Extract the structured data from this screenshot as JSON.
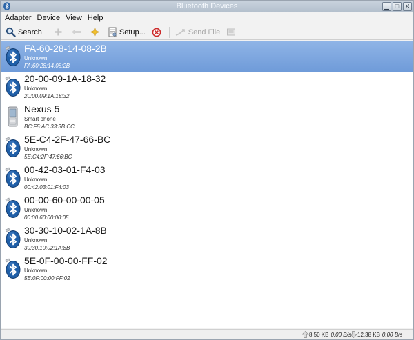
{
  "window": {
    "title": "Bluetooth Devices"
  },
  "menu": [
    {
      "first": "A",
      "rest": "dapter"
    },
    {
      "first": "D",
      "rest": "evice"
    },
    {
      "first": "V",
      "rest": "iew"
    },
    {
      "first": "H",
      "rest": "elp"
    }
  ],
  "toolbar": {
    "search_label": "Search",
    "setup_label": "Setup...",
    "send_file_label": "Send File"
  },
  "devices": [
    {
      "name": "FA-60-28-14-08-2B",
      "type": "Unknown",
      "address": "FA:60:28:14:08:2B",
      "icon": "bluetooth-icon",
      "selected": true
    },
    {
      "name": "20-00-09-1A-18-32",
      "type": "Unknown",
      "address": "20:00:09:1A:18:32",
      "icon": "bluetooth-icon",
      "selected": false
    },
    {
      "name": "Nexus 5",
      "type": "Smart phone",
      "address": "BC:F5:AC:33:3B:CC",
      "icon": "phone-icon",
      "selected": false
    },
    {
      "name": "5E-C4-2F-47-66-BC",
      "type": "Unknown",
      "address": "5E:C4:2F:47:66:BC",
      "icon": "bluetooth-icon",
      "selected": false
    },
    {
      "name": "00-42-03-01-F4-03",
      "type": "Unknown",
      "address": "00:42:03:01:F4:03",
      "icon": "bluetooth-icon",
      "selected": false
    },
    {
      "name": "00-00-60-00-00-05",
      "type": "Unknown",
      "address": "00:00:60:00:00:05",
      "icon": "bluetooth-icon",
      "selected": false
    },
    {
      "name": "30-30-10-02-1A-8B",
      "type": "Unknown",
      "address": "30:30:10:02:1A:8B",
      "icon": "bluetooth-icon",
      "selected": false
    },
    {
      "name": "5E-0F-00-00-FF-02",
      "type": "Unknown",
      "address": "5E:0F:00:00:FF:02",
      "icon": "bluetooth-icon",
      "selected": false
    }
  ],
  "status": {
    "upload_total": "8.50 KB",
    "upload_rate": "0.00 B/s",
    "download_total": "12.38 KB",
    "download_rate": "0.00 B/s"
  },
  "colors": {
    "selection": "#7aa3dc",
    "bluetooth": "#1f5fa8"
  }
}
